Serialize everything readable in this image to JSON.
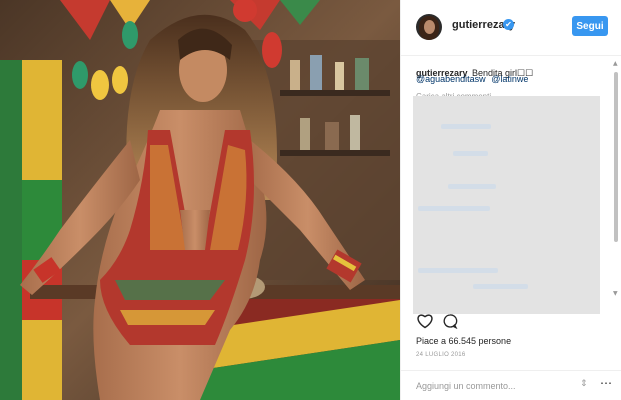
{
  "post": {
    "username": "gutierrezary",
    "verified_mark": "✔",
    "follow_label": "Segui",
    "caption_user": "gutierrezary",
    "caption_text": "Bendita girl☐☐",
    "mentions": [
      "@aguabenditasw",
      "@latinwe"
    ],
    "load_more": "Carica altri commenti",
    "likes_text": "Piace a 66.545 persone",
    "date": "24 LUGLIO 2016",
    "comment_placeholder": "Aggiungi un commento...",
    "emoji_icon": "⇕",
    "more_icon": "⋯"
  },
  "icons": {
    "like": "heart-icon",
    "comment": "comment-bubble-icon",
    "verified": "verified-badge-icon"
  },
  "colors": {
    "accent": "#3897f0",
    "link": "#003569",
    "muted": "#999999"
  }
}
